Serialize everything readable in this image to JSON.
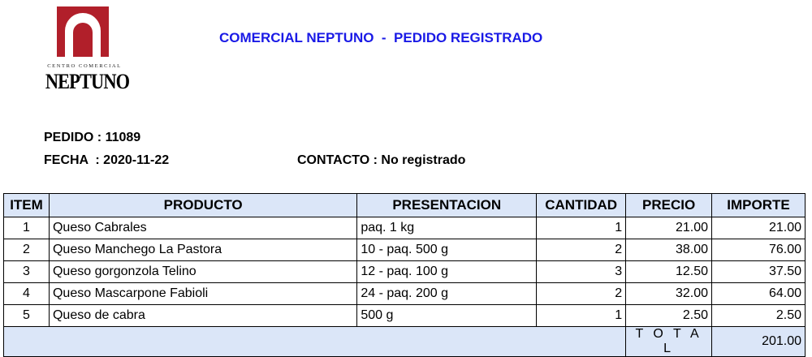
{
  "logo": {
    "subtitle": "CENTRO COMERCIAL",
    "name": "NEPTUNO",
    "color": "#b11f2a"
  },
  "header": {
    "title": "COMERCIAL NEPTUNO  -  PEDIDO REGISTRADO",
    "title_color": "#1a1ae6"
  },
  "order": {
    "pedido": "PEDIDO : 11089",
    "fecha": "FECHA  : 2020-11-22",
    "contacto": "CONTACTO : No registrado"
  },
  "table": {
    "header_bg": "#dbe6f8",
    "columns": [
      "ITEM",
      "PRODUCTO",
      "PRESENTACION",
      "CANTIDAD",
      "PRECIO",
      "IMPORTE"
    ],
    "rows": [
      {
        "item": "1",
        "producto": "Queso Cabrales",
        "presentacion": "paq. 1 kg",
        "cantidad": "1",
        "precio": "21.00",
        "importe": "21.00"
      },
      {
        "item": "2",
        "producto": "Queso Manchego La Pastora",
        "presentacion": "10 - paq. 500 g",
        "cantidad": "2",
        "precio": "38.00",
        "importe": "76.00"
      },
      {
        "item": "3",
        "producto": "Queso gorgonzola Telino",
        "presentacion": "12 - paq. 100 g",
        "cantidad": "3",
        "precio": "12.50",
        "importe": "37.50"
      },
      {
        "item": "4",
        "producto": "Queso Mascarpone Fabioli",
        "presentacion": "24 - paq. 200 g",
        "cantidad": "2",
        "precio": "32.00",
        "importe": "64.00"
      },
      {
        "item": "5",
        "producto": "Queso de cabra",
        "presentacion": "500 g",
        "cantidad": "1",
        "precio": "2.50",
        "importe": "2.50"
      }
    ],
    "total_label": "TOTAL",
    "total_value": "201.00"
  }
}
